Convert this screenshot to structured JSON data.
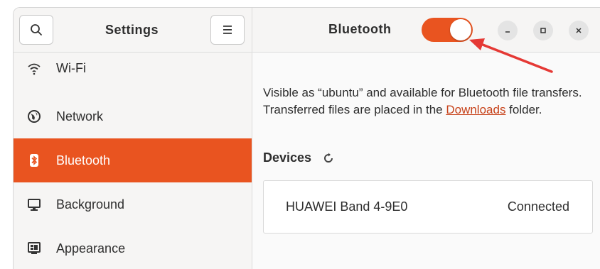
{
  "sidebar": {
    "title": "Settings",
    "search_icon": "search-icon",
    "menu_icon": "hamburger-menu-icon",
    "items": [
      {
        "label": "Wi-Fi",
        "icon": "wifi-icon"
      },
      {
        "label": "Network",
        "icon": "network-globe-icon"
      },
      {
        "label": "Bluetooth",
        "icon": "bluetooth-icon",
        "active": true
      },
      {
        "label": "Background",
        "icon": "monitor-icon"
      },
      {
        "label": "Appearance",
        "icon": "appearance-icon"
      }
    ]
  },
  "header": {
    "title": "Bluetooth",
    "toggle_on": true,
    "window_controls": [
      "minimize",
      "maximize",
      "close"
    ]
  },
  "main": {
    "description_part1": "Visible as “ubuntu” and available for Bluetooth file transfers. Transferred files are placed in the ",
    "downloads_link": "Downloads",
    "description_part2": " folder.",
    "devices_label": "Devices",
    "devices": [
      {
        "name": "HUAWEI Band 4-9E0",
        "status": "Connected"
      }
    ]
  },
  "colors": {
    "accent": "#e95420",
    "link": "#c7421a",
    "annotation_arrow": "#e53935"
  }
}
